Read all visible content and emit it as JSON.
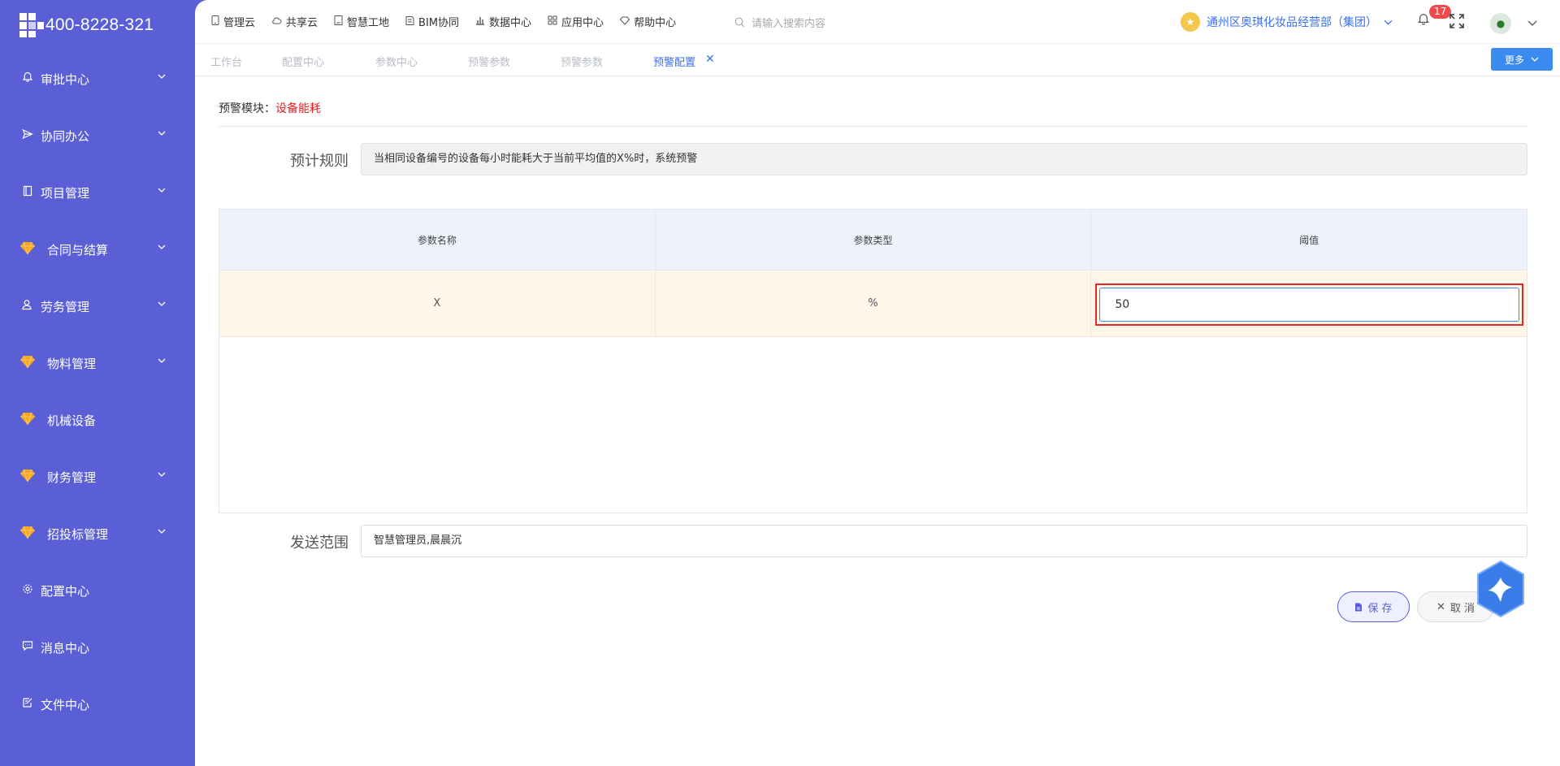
{
  "brand": {
    "phone": "400-8228-321"
  },
  "sidebar": {
    "items": [
      {
        "label": "审批中心",
        "icon": "bell-icon",
        "expandable": true
      },
      {
        "label": "协同办公",
        "icon": "send-icon",
        "expandable": true
      },
      {
        "label": "项目管理",
        "icon": "book-icon",
        "expandable": true
      },
      {
        "label": "合同与结算",
        "icon": "gem-icon",
        "expandable": true
      },
      {
        "label": "劳务管理",
        "icon": "user-icon",
        "expandable": true
      },
      {
        "label": "物料管理",
        "icon": "gem-icon",
        "expandable": true
      },
      {
        "label": "机械设备",
        "icon": "gem-icon",
        "expandable": false
      },
      {
        "label": "财务管理",
        "icon": "gem-icon",
        "expandable": true
      },
      {
        "label": "招投标管理",
        "icon": "gem-icon",
        "expandable": true
      },
      {
        "label": "配置中心",
        "icon": "gear-icon",
        "expandable": false
      },
      {
        "label": "消息中心",
        "icon": "chat-icon",
        "expandable": false
      },
      {
        "label": "文件中心",
        "icon": "edit-icon",
        "expandable": false
      }
    ]
  },
  "topnav": {
    "items": [
      {
        "label": "管理云",
        "icon": "phone-icon"
      },
      {
        "label": "共享云",
        "icon": "cloud-icon"
      },
      {
        "label": "智慧工地",
        "icon": "doc-icon"
      },
      {
        "label": "BIM协同",
        "icon": "cube-icon"
      },
      {
        "label": "数据中心",
        "icon": "bar-chart-icon"
      },
      {
        "label": "应用中心",
        "icon": "grid-icon"
      },
      {
        "label": "帮助中心",
        "icon": "diamond-icon"
      }
    ],
    "search_placeholder": "请输入搜索内容",
    "org_name": "通州区奥琪化妆品经营部（集团）",
    "notification_count": "17"
  },
  "tabs": {
    "items": [
      "工作台",
      "配置中心",
      "参数中心",
      "预警参数",
      "预警参数",
      "预警配置"
    ],
    "active_index": 5,
    "more_label": "更多"
  },
  "form": {
    "module_label": "预警模块：",
    "module_value": "设备能耗",
    "rule_label": "预计规则",
    "rule_value": "当相同设备编号的设备每小时能耗大于当前平均值的X%时，系统预警",
    "table": {
      "headers": [
        "参数名称",
        "参数类型",
        "阈值"
      ],
      "rows": [
        {
          "name": "X",
          "type": "%",
          "threshold": "50"
        }
      ]
    },
    "scope_label": "发送范围",
    "scope_value": "智慧管理员,晨晨沉",
    "save_label": "保 存",
    "cancel_label": "取 消"
  },
  "colors": {
    "sidebar_bg": "#5b5fd6",
    "accent": "#3a71e8",
    "alert_red": "#e02020",
    "row_highlight": "#fff6ea"
  }
}
